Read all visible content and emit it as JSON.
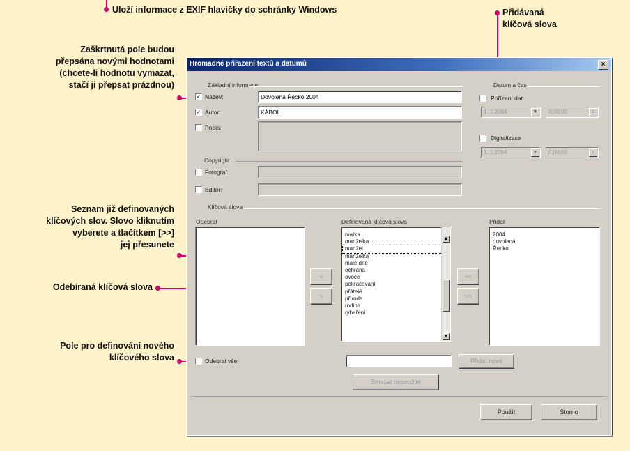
{
  "annotations": {
    "exif_clipboard": "Uloží informace z EXIF hlavičky do schránky Windows",
    "added_keywords": [
      "Přidávaná",
      "klíčová slova"
    ],
    "checked_fields": [
      "Zaškrtnutá pole budou",
      "přepsána novými hodnotami",
      "(chcete-li hodnotu vymazat,",
      "stačí ji přepsat prázdnou)"
    ],
    "defined_keywords": [
      "Seznam již definovaných",
      "klíčových slov. Slovo kliknutím",
      "vyberete a tlačítkem [>>]",
      "jej přesunete"
    ],
    "removed_keywords": "Odebíraná klíčová slova",
    "new_keyword_field": [
      "Pole pro definování nového",
      "klíčového slova"
    ]
  },
  "dialog": {
    "title": "Hromadné přiřazení textů a datumů",
    "close": "×",
    "basic_group": "Základní informace",
    "fields": [
      {
        "label": "Název:",
        "checked": true,
        "value": "Dovolená Řecko 2004"
      },
      {
        "label": "Autor:",
        "checked": true,
        "value": "KÁBOL"
      },
      {
        "label": "Popis:",
        "checked": false,
        "value": ""
      }
    ],
    "copyright_group": "Copyright",
    "copyright_fields": [
      {
        "label": "Fotograf:",
        "checked": false
      },
      {
        "label": "Editor:",
        "checked": false
      }
    ],
    "datetime_group": "Datum a čas",
    "date_fields": [
      {
        "label": "Pořízení dat",
        "checked": false,
        "date": "1. 1.2004",
        "time": "0:00:00"
      },
      {
        "label": "Digitalizace",
        "checked": false,
        "date": "1. 1.2004",
        "time": "0:00:00"
      }
    ],
    "keywords_group": "Klíčová slova",
    "remove_label": "Odebrat",
    "defined_label": "Definovaná klíčová slova",
    "defined_items": [
      "matka",
      "manželka",
      "manžel",
      "manželka",
      "malé dítě",
      "ochrana",
      "ovoce",
      "pokračování",
      "přátelé",
      "příroda",
      "rodina",
      "rybaření"
    ],
    "add_label": "Přidat",
    "add_items": [
      "2004",
      "dovolená",
      "Řecko"
    ],
    "move_buttons": [
      "<",
      ">",
      "<<",
      ">>"
    ],
    "remove_all_label": "Odebrat vše",
    "define_button": "Přidat nové",
    "clear_button": "Smazat nepoužité",
    "ok_button": "Použít",
    "cancel_button": "Storno"
  },
  "colors": {
    "accent": "#d3006f",
    "background": "#fdf2c9",
    "dialog": "#d4d0c8",
    "titlebar": "#0a246a"
  }
}
